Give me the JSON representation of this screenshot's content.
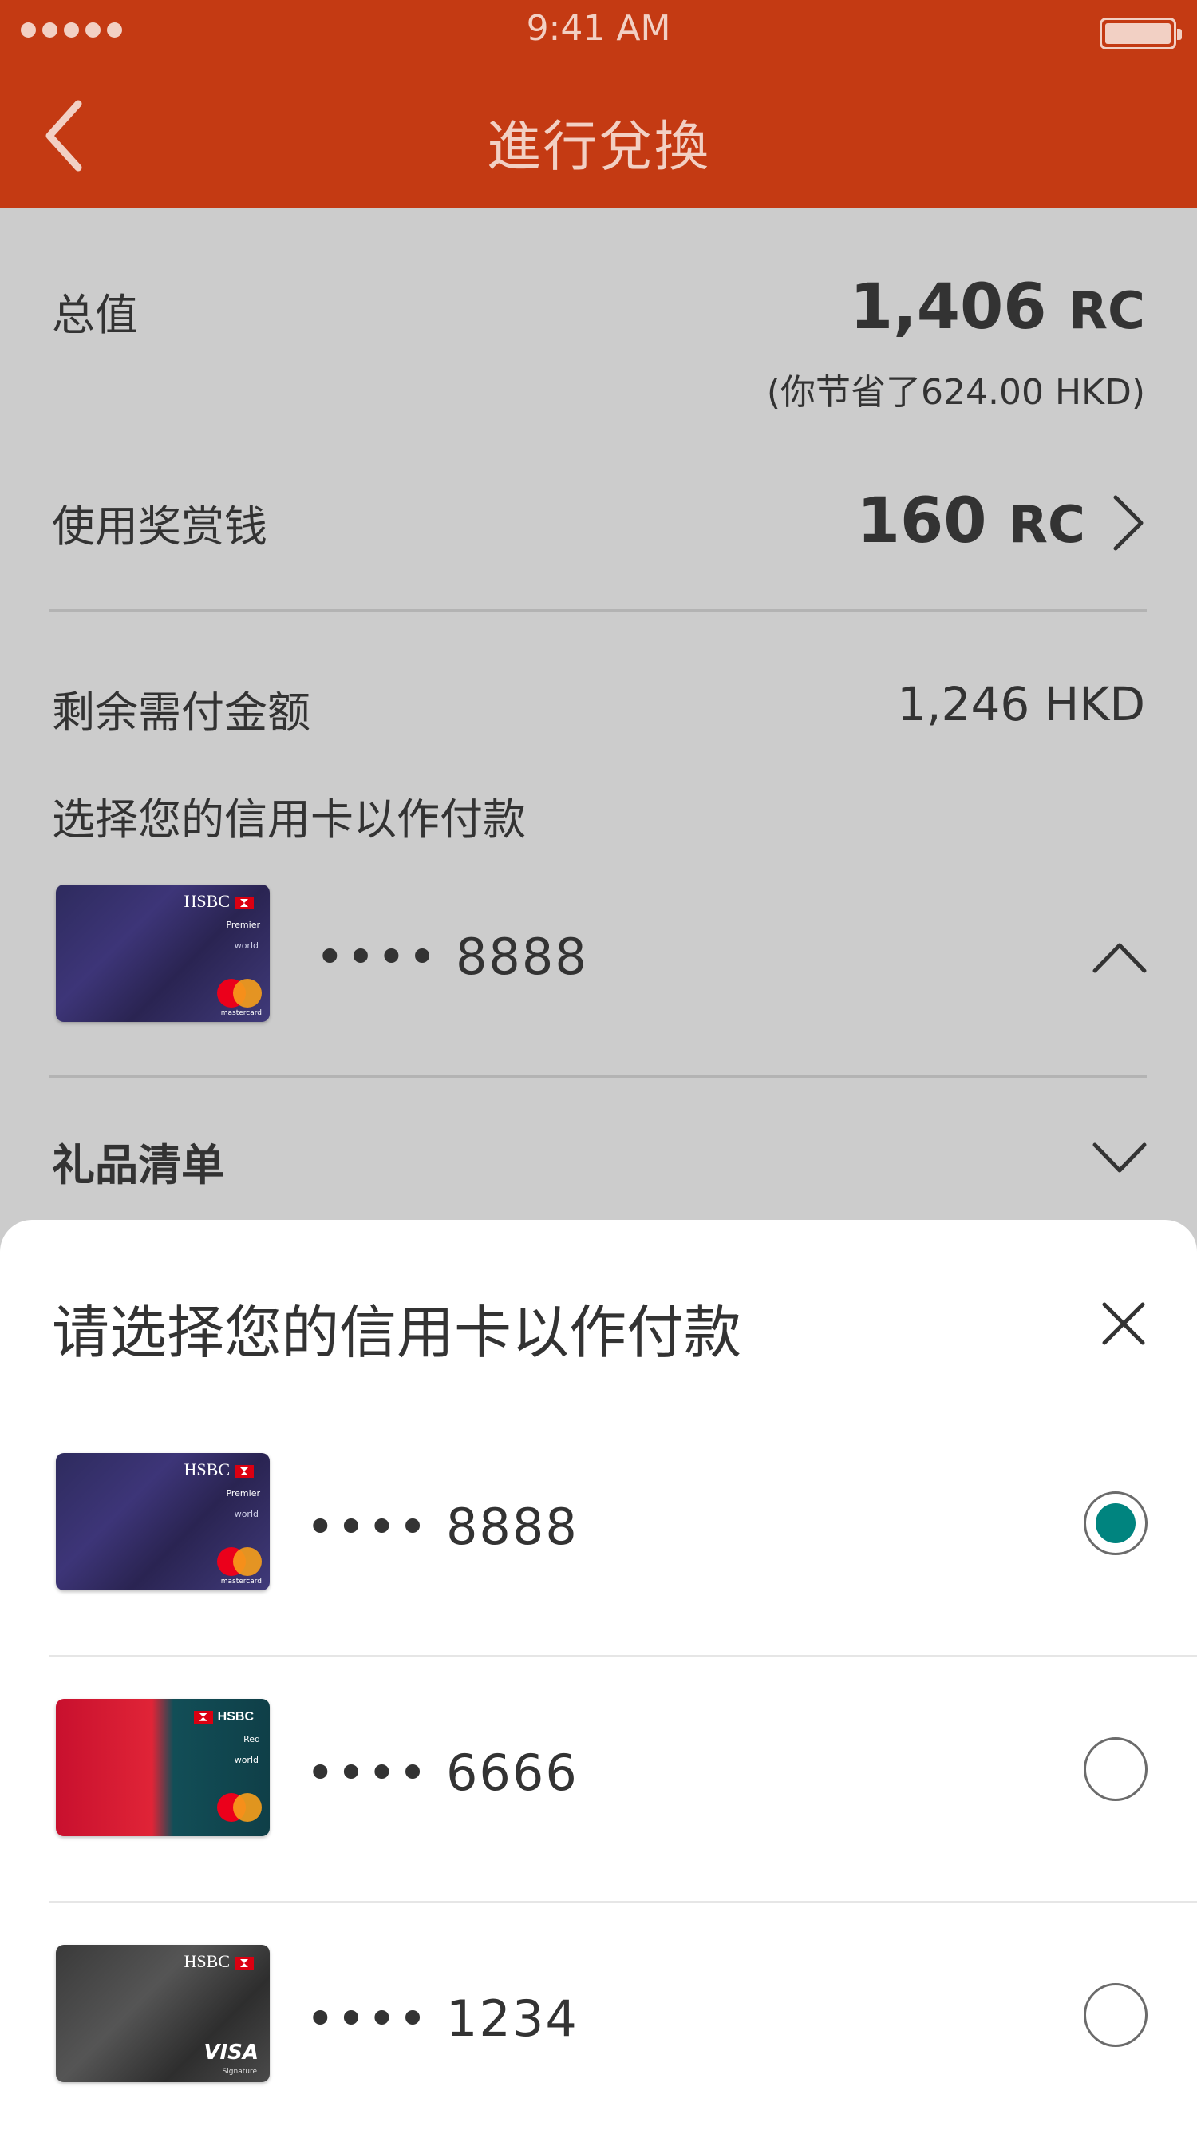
{
  "status": {
    "time": "9:41 AM"
  },
  "header": {
    "title": "進行兌換"
  },
  "summary": {
    "total_label": "总值",
    "total_amount": "1,406",
    "total_unit": "RC",
    "saving_text": "(你节省了624.00 HKD)",
    "reward_label": "使用奖赏钱",
    "reward_amount": "160",
    "reward_unit": "RC",
    "remaining_label": "剩余需付金额",
    "remaining_value": "1,246 HKD",
    "choose_card_label": "选择您的信用卡以作付款",
    "selected_card_number": "•••• 8888",
    "gift_list_label": "礼品清单"
  },
  "sheet": {
    "title": "请选择您的信用卡以作付款",
    "options": [
      {
        "number": "•••• 8888",
        "brand": "HSBC",
        "tier": "Premier",
        "tier_sub": "world",
        "network": "mastercard",
        "selected": true
      },
      {
        "number": "•••• 6666",
        "brand": "HSBC",
        "tier": "Red",
        "tier_sub": "world",
        "network": "mastercard",
        "selected": false
      },
      {
        "number": "•••• 1234",
        "brand": "HSBC",
        "tier": "",
        "tier_sub": "Signature",
        "network": "VISA",
        "selected": false
      }
    ]
  },
  "colors": {
    "header_bg": "#c43a13",
    "overlay_bg": "#cccccc",
    "radio_selected": "#00847f"
  },
  "icons": [
    "back-icon",
    "chevron-right-icon",
    "chevron-up-icon",
    "chevron-down-icon",
    "close-icon",
    "radio-icon"
  ]
}
